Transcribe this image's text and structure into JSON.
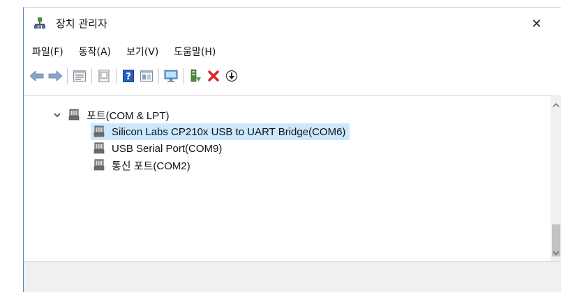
{
  "window": {
    "title": "장치 관리자",
    "close_glyph": "✕"
  },
  "menu": [
    {
      "label": "파일(F)"
    },
    {
      "label": "동작(A)"
    },
    {
      "label": "보기(V)"
    },
    {
      "label": "도움말(H)"
    }
  ],
  "toolbar": {
    "icons": [
      "back-arrow-icon",
      "forward-arrow-icon",
      "properties-icon",
      "show-hidden-icon",
      "help-icon",
      "action-view-icon",
      "monitor-icon",
      "update-driver-icon",
      "uninstall-x-icon",
      "download-circle-icon"
    ]
  },
  "tree": {
    "category": {
      "label": "포트(COM & LPT)",
      "expanded": true
    },
    "devices": [
      {
        "label": "Silicon Labs CP210x USB to UART Bridge(COM6)",
        "selected": true
      },
      {
        "label": "USB Serial Port(COM9)",
        "selected": false
      },
      {
        "label": "통신 포트(COM2)",
        "selected": false
      }
    ]
  },
  "colors": {
    "selection": "#cce8ff",
    "delete_red": "#e0201c",
    "help_blue": "#2a5fbf"
  }
}
